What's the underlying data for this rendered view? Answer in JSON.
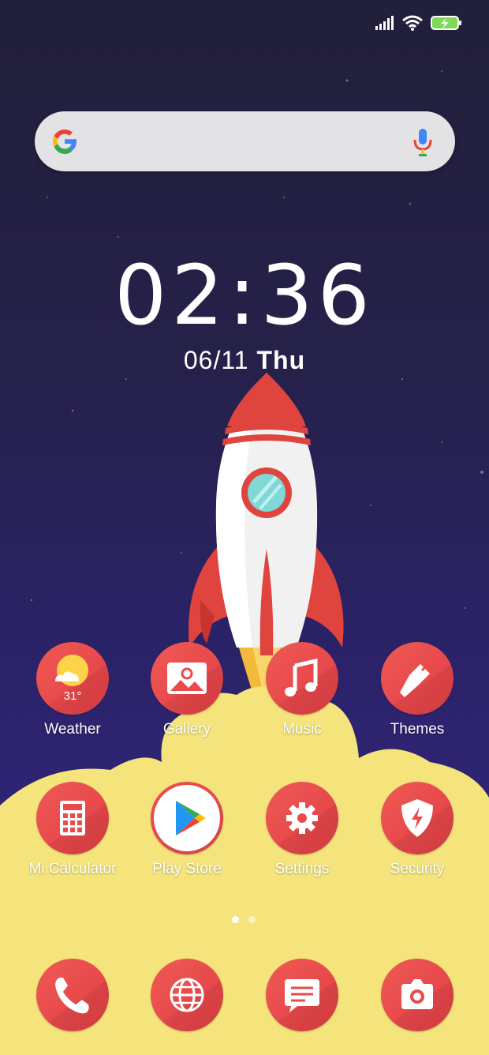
{
  "status_bar": {
    "signal_icon": "signal-icon",
    "wifi_icon": "wifi-icon",
    "battery_icon": "battery-charging-icon"
  },
  "search": {
    "logo_icon": "google-g-icon",
    "mic_icon": "mic-icon"
  },
  "clock": {
    "hours": "02",
    "separator": ":",
    "minutes": "36"
  },
  "date": {
    "day": "06/11",
    "weekday": "Thu"
  },
  "weather": {
    "temperature": "31°"
  },
  "apps_row1": [
    {
      "label": "Weather",
      "icon": "weather-icon"
    },
    {
      "label": "Gallery",
      "icon": "gallery-icon"
    },
    {
      "label": "Music",
      "icon": "music-icon"
    },
    {
      "label": "Themes",
      "icon": "themes-icon"
    }
  ],
  "apps_row2": [
    {
      "label": "Mi Calculator",
      "icon": "calculator-icon"
    },
    {
      "label": "Play Store",
      "icon": "play-store-icon"
    },
    {
      "label": "Settings",
      "icon": "settings-icon"
    },
    {
      "label": "Security",
      "icon": "security-icon"
    }
  ],
  "dock": [
    {
      "icon": "phone-icon"
    },
    {
      "icon": "browser-icon"
    },
    {
      "icon": "messages-icon"
    },
    {
      "icon": "camera-icon"
    }
  ],
  "page_indicator": {
    "pages": 2,
    "active": 1
  },
  "colors": {
    "icon_red": "#e94b4d",
    "cloud_yellow": "#f4e47b",
    "sky": "#26214a"
  }
}
